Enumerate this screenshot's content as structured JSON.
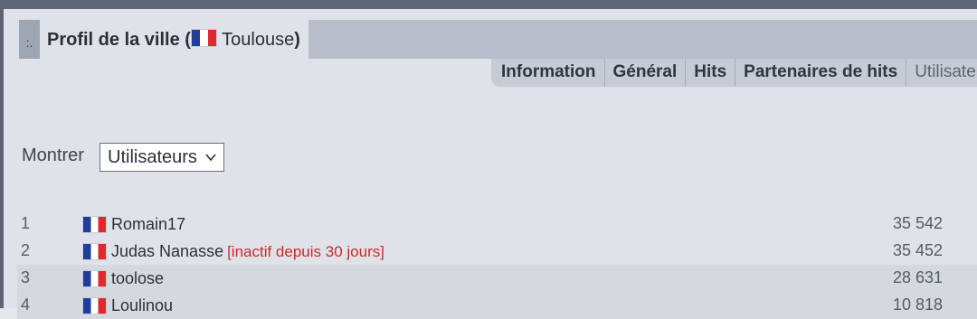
{
  "title": {
    "dots": ":.",
    "prefix": "Profil de la ville (",
    "city": "Toulouse",
    "suffix": ")"
  },
  "tabs": [
    {
      "label": "Information"
    },
    {
      "label": "Général"
    },
    {
      "label": "Hits"
    },
    {
      "label": "Partenaires de hits"
    },
    {
      "label": "Utilisateurs"
    }
  ],
  "active_tab": "Utilisateurs",
  "filter": {
    "label": "Montrer",
    "value": "Utilisateurs"
  },
  "users": [
    {
      "rank": "1",
      "name": "Romain17",
      "note": "",
      "hits": "35 542",
      "country": "France"
    },
    {
      "rank": "2",
      "name": "Judas Nanasse",
      "note": "[inactif depuis 30 jours]",
      "hits": "35 452",
      "country": "France"
    },
    {
      "rank": "3",
      "name": "toolose",
      "note": "",
      "hits": "28 631",
      "country": "France"
    },
    {
      "rank": "4",
      "name": "Loulinou",
      "note": "",
      "hits": "10 818",
      "country": "France"
    }
  ],
  "colors": {
    "flag_blue": "#1f3d9a",
    "flag_red": "#e0282f",
    "inactive_red": "#d02a2a"
  }
}
